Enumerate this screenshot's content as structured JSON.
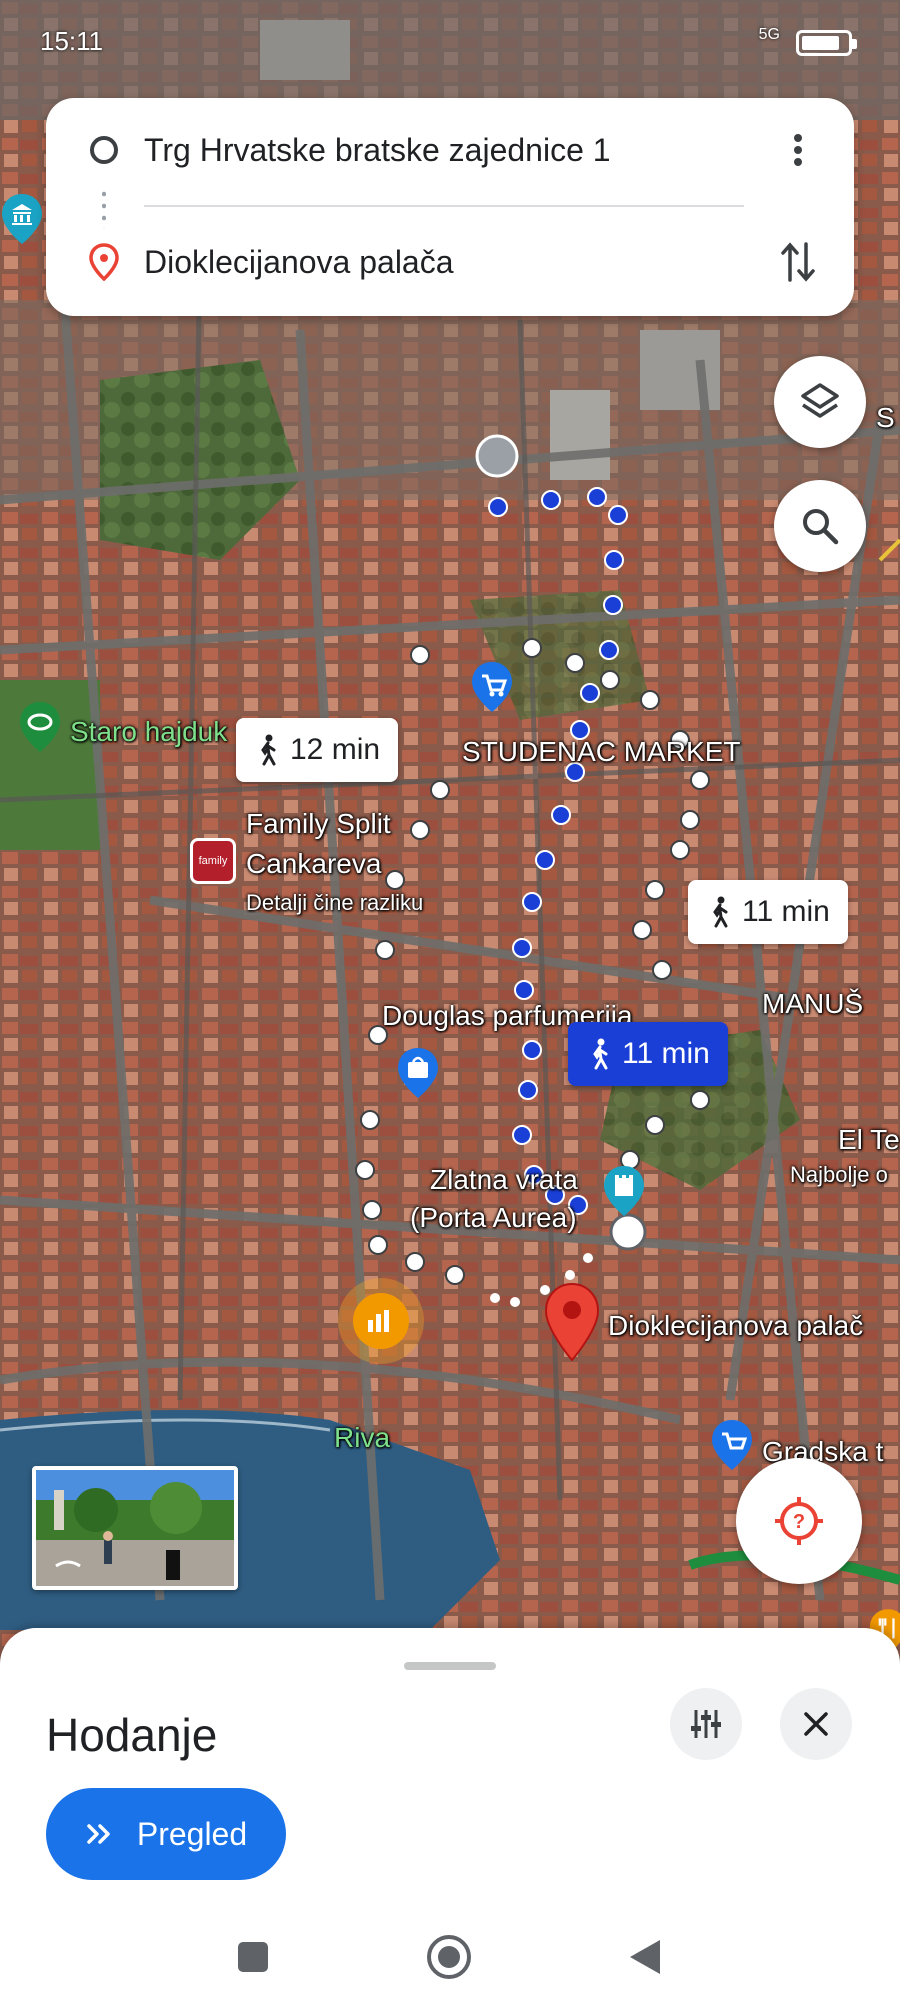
{
  "status_bar": {
    "time": "15:11",
    "signal": "5G",
    "battery_level": 0.85
  },
  "route": {
    "origin": "Trg Hrvatske bratske zajednice 1",
    "destination": "Dioklecijanova palača"
  },
  "map_labels": {
    "staro_hajduk": "Staro hajduk",
    "studenac": "STUDENAC MARKET",
    "family_line1": "Family Split",
    "family_line2": "Cankareva",
    "family_sub": "Detalji čine razliku",
    "family_logo": "family",
    "douglas": "Douglas parfumerija",
    "manus": "MANUŠ",
    "zlatna1": "Zlatna vrata",
    "zlatna2": "(Porta Aurea)",
    "diokle": "Dioklecijanova palač",
    "riva": "Riva",
    "gradska": "Gradska t",
    "el_te": "El Te",
    "najbolje": "Najbolje o",
    "edge_s": "S"
  },
  "route_chips": [
    {
      "label": "12 min",
      "active": false
    },
    {
      "label": "11 min",
      "active": false
    },
    {
      "label": "11 min",
      "active": true
    }
  ],
  "icons": {
    "more": "more-vert-icon",
    "swap": "swap-vert-icon",
    "layers": "layers-icon",
    "search": "search-icon",
    "locate": "gps-locate-icon",
    "filter": "tune-icon",
    "close": "close-icon",
    "preview": "double-chevron-icon"
  },
  "sheet": {
    "title": "Hodanje",
    "preview_label": "Pregled"
  },
  "colors": {
    "primary_blue": "#1a73e8",
    "active_chip": "#1a3fd6",
    "pin_red": "#ea4335"
  }
}
